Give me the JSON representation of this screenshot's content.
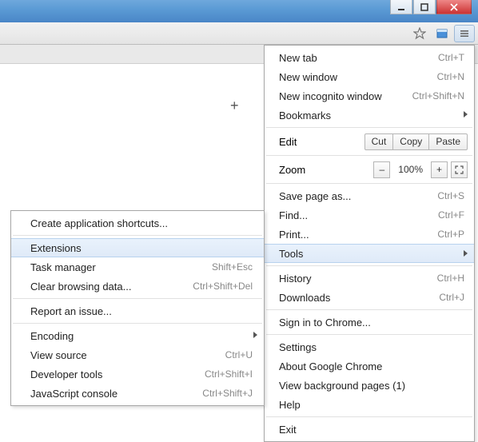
{
  "main_menu": {
    "new_tab": "New tab",
    "new_tab_sc": "Ctrl+T",
    "new_window": "New window",
    "new_window_sc": "Ctrl+N",
    "new_incognito": "New incognito window",
    "new_incognito_sc": "Ctrl+Shift+N",
    "bookmarks": "Bookmarks",
    "edit": "Edit",
    "cut": "Cut",
    "copy": "Copy",
    "paste": "Paste",
    "zoom": "Zoom",
    "zoom_minus": "–",
    "zoom_pct": "100%",
    "zoom_plus": "+",
    "save_page": "Save page as...",
    "save_page_sc": "Ctrl+S",
    "find": "Find...",
    "find_sc": "Ctrl+F",
    "print": "Print...",
    "print_sc": "Ctrl+P",
    "tools": "Tools",
    "history": "History",
    "history_sc": "Ctrl+H",
    "downloads": "Downloads",
    "downloads_sc": "Ctrl+J",
    "signin": "Sign in to Chrome...",
    "settings": "Settings",
    "about": "About Google Chrome",
    "bg_pages": "View background pages (1)",
    "help": "Help",
    "exit": "Exit"
  },
  "tools_menu": {
    "create_shortcuts": "Create application shortcuts...",
    "extensions": "Extensions",
    "task_manager": "Task manager",
    "task_manager_sc": "Shift+Esc",
    "clear_data": "Clear browsing data...",
    "clear_data_sc": "Ctrl+Shift+Del",
    "report_issue": "Report an issue...",
    "encoding": "Encoding",
    "view_source": "View source",
    "view_source_sc": "Ctrl+U",
    "dev_tools": "Developer tools",
    "dev_tools_sc": "Ctrl+Shift+I",
    "js_console": "JavaScript console",
    "js_console_sc": "Ctrl+Shift+J"
  },
  "content": {
    "plus": "+"
  }
}
